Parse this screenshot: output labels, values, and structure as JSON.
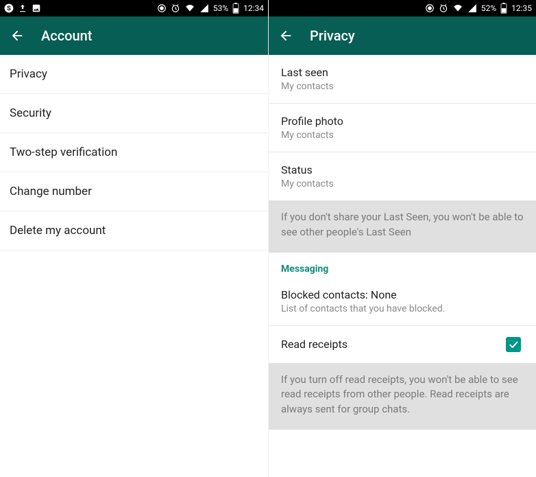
{
  "left": {
    "status": {
      "battery_pct": "53%",
      "time": "12:34"
    },
    "header": {
      "title": "Account"
    },
    "items": [
      {
        "label": "Privacy"
      },
      {
        "label": "Security"
      },
      {
        "label": "Two-step verification"
      },
      {
        "label": "Change number"
      },
      {
        "label": "Delete my account"
      }
    ]
  },
  "right": {
    "status": {
      "battery_pct": "52%",
      "time": "12:35"
    },
    "header": {
      "title": "Privacy"
    },
    "items": [
      {
        "primary": "Last seen",
        "secondary": "My contacts"
      },
      {
        "primary": "Profile photo",
        "secondary": "My contacts"
      },
      {
        "primary": "Status",
        "secondary": "My contacts"
      }
    ],
    "info1": "If you don't share your Last Seen, you won't be able to see other people's Last Seen",
    "section": "Messaging",
    "blocked": {
      "primary": "Blocked contacts: None",
      "secondary": "List of contacts that you have blocked."
    },
    "read_receipts": {
      "primary": "Read receipts",
      "checked": true
    },
    "info2": "If you turn off read receipts, you won't be able to see read receipts from other people. Read receipts are always sent for group chats."
  }
}
